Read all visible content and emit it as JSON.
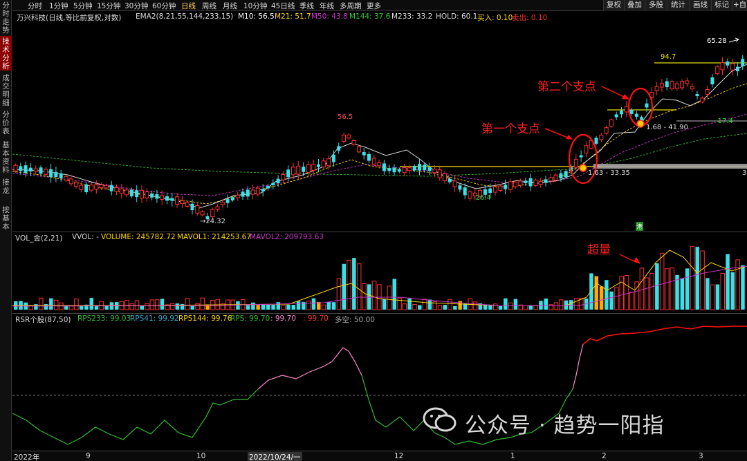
{
  "sidebar": {
    "tabs": [
      {
        "label": "分时走势",
        "active": false
      },
      {
        "label": "技术分析",
        "active": true
      },
      {
        "label": "成交明细",
        "active": false
      },
      {
        "label": "分价表",
        "active": false
      },
      {
        "label": "基本资料",
        "active": false
      },
      {
        "label": "接龙",
        "active": false
      },
      {
        "label": "按基本",
        "active": false
      }
    ]
  },
  "toolbar": {
    "periods": [
      "分时",
      "1分钟",
      "5分钟",
      "15分钟",
      "30分钟",
      "60分钟",
      "日线",
      "周线",
      "月线",
      "10分钟",
      "45日线",
      "季线",
      "年线",
      "多周期",
      "更多"
    ],
    "active_period": "日线",
    "buttons": [
      "复权",
      "叠加",
      "多股",
      "统计",
      "画线",
      "标记",
      "+自选"
    ]
  },
  "main_info": {
    "stock": "万兴科技(日线,等比前复权,对数)",
    "indicator": "EMA2(8,21,55,144,233,15)",
    "m10": "M10: 56.5",
    "m21": "M21: 51.7",
    "m50": "M50: 43.8",
    "m144": "M144: 37.6",
    "m233": "M233: 33.2",
    "hold": "HOLD: 60.1",
    "buy": "买入: 0.10",
    "sell": "卖出: 0.10"
  },
  "price_labels": {
    "high1": "56.5",
    "low1": "24.32",
    "low2": "-26.4",
    "zone1": "1.63 - 33.35",
    "zone2": "1.68 - 41.90",
    "low3": "-17.4",
    "level": "94.7",
    "high2": "65.28",
    "right_edge": "3"
  },
  "annotations": {
    "first": "第一个支点",
    "second": "第二个支点",
    "volume": "超量"
  },
  "badge": "港",
  "volume_info": {
    "title": "VOL_金(2,21)",
    "vvol": "VVOL: -",
    "volume": "VOLUME: 245782.72",
    "mavol1": "MAVOL1: 214253.67",
    "mavol2": "MAVOL2: 209793.63"
  },
  "rsr_info": {
    "title": "RSR个股(87,50)",
    "rps233": "RPS233: 99.03",
    "rps41": "RPS41: 99.92",
    "rps144": "RPS144: 99.76",
    "rps": "RPS: 99.70",
    "v1": ": 99.70",
    "v2": ": 99.70",
    "kk": "多空: 50.00"
  },
  "xaxis": [
    "2022年",
    "9",
    "10",
    "2022/10/24/一",
    "12",
    "1",
    "2",
    "3"
  ],
  "watermark": {
    "text": "公众号 · 趋势一阳指"
  },
  "colors": {
    "up": "#ff3030",
    "down": "#39e0e8",
    "ma10": "#ffffff",
    "ma21": "#ffd700",
    "ma50": "#cc33cc",
    "ma144": "#33cc33",
    "rsr_high": "#ff0000",
    "rsr_mid": "#ff88cc",
    "rsr_low": "#33bb33"
  }
}
